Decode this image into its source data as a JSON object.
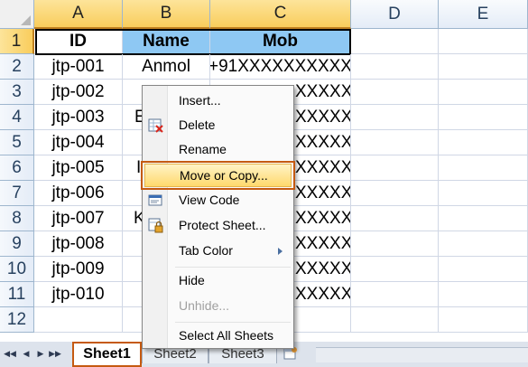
{
  "columns": [
    "A",
    "B",
    "C",
    "D",
    "E"
  ],
  "rows": [
    "1",
    "2",
    "3",
    "4",
    "5",
    "6",
    "7",
    "8",
    "9",
    "10",
    "11",
    "12"
  ],
  "grid": {
    "header": {
      "id": "ID",
      "name": "Name",
      "mob": "Mob"
    },
    "data": [
      {
        "id": "jtp-001",
        "name": "Anmol",
        "mob": "+91XXXXXXXXXX"
      },
      {
        "id": "jtp-002",
        "name": "",
        "mob": "XXXXX"
      },
      {
        "id": "jtp-003",
        "name": "E",
        "mob": "XXXXX"
      },
      {
        "id": "jtp-004",
        "name": "",
        "mob": "XXXXX"
      },
      {
        "id": "jtp-005",
        "name": "I",
        "mob": "XXXXX"
      },
      {
        "id": "jtp-006",
        "name": "",
        "mob": "XXXXX"
      },
      {
        "id": "jtp-007",
        "name": "K",
        "mob": "XXXXX"
      },
      {
        "id": "jtp-008",
        "name": "",
        "mob": "XXXXX"
      },
      {
        "id": "jtp-009",
        "name": "",
        "mob": "XXXXX"
      },
      {
        "id": "jtp-010",
        "name": "",
        "mob": "XXXXX"
      }
    ]
  },
  "context_menu": {
    "items": [
      {
        "label": "Insert...",
        "icon": ""
      },
      {
        "label": "Delete",
        "icon": "delete-sheet-icon"
      },
      {
        "label": "Rename",
        "icon": ""
      },
      {
        "label": "Move or Copy...",
        "icon": "",
        "highlighted": true
      },
      {
        "label": "View Code",
        "icon": "view-code-icon"
      },
      {
        "label": "Protect Sheet...",
        "icon": "protect-sheet-icon"
      },
      {
        "label": "Tab Color",
        "icon": "",
        "submenu": true
      },
      {
        "label": "Hide",
        "icon": ""
      },
      {
        "label": "Unhide...",
        "icon": "",
        "disabled": true
      },
      {
        "label": "Select All Sheets",
        "icon": ""
      }
    ]
  },
  "tabs": {
    "sheets": [
      "Sheet1",
      "Sheet2",
      "Sheet3"
    ],
    "active": "Sheet1",
    "new_sheet_icon": "insert-worksheet-icon"
  },
  "colors": {
    "header_fill": "#8ec8f3",
    "highlight_outline": "#c55a11",
    "menu_highlight": "#ffd96d"
  }
}
